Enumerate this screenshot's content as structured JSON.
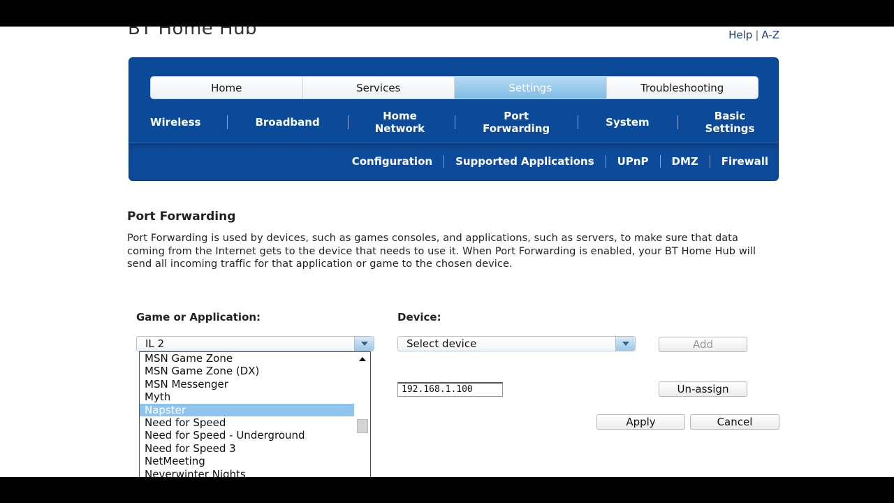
{
  "brand": "BT Home Hub",
  "help_links": {
    "help": "Help",
    "separator": "|",
    "az": "A-Z"
  },
  "main_tabs": [
    {
      "label": "Home",
      "active": false
    },
    {
      "label": "Services",
      "active": false
    },
    {
      "label": "Settings",
      "active": true
    },
    {
      "label": "Troubleshooting",
      "active": false
    }
  ],
  "sub_tabs": [
    {
      "label": "Wireless"
    },
    {
      "label": "Broadband"
    },
    {
      "label": "Home\nNetwork"
    },
    {
      "label": "Port\nForwarding"
    },
    {
      "label": "System"
    },
    {
      "label": "Basic\nSettings"
    }
  ],
  "third_tabs": [
    {
      "label": "Configuration"
    },
    {
      "label": "Supported Applications"
    },
    {
      "label": "UPnP"
    },
    {
      "label": "DMZ"
    },
    {
      "label": "Firewall"
    }
  ],
  "section": {
    "title": "Port Forwarding",
    "description": "Port Forwarding is used by devices, such as games consoles, and applications, such as servers, to make sure that data coming from the Internet gets to the device that needs to use it. When Port Forwarding is enabled, your BT Home Hub will send all incoming traffic for that application or game to the chosen device."
  },
  "form": {
    "game_label": "Game or Application:",
    "game_value": "IL 2",
    "device_label": "Device:",
    "device_value": "Select device",
    "add_label": "Add",
    "ip_value": "192.168.1.100",
    "unassign_label": "Un-assign",
    "apply_label": "Apply",
    "cancel_label": "Cancel"
  },
  "dropdown_items": [
    {
      "label": "MSN Game Zone",
      "selected": false
    },
    {
      "label": "MSN Game Zone (DX)",
      "selected": false
    },
    {
      "label": "MSN Messenger",
      "selected": false
    },
    {
      "label": "Myth",
      "selected": false
    },
    {
      "label": "Napster",
      "selected": true
    },
    {
      "label": "Need for Speed",
      "selected": false
    },
    {
      "label": "Need for Speed - Underground",
      "selected": false
    },
    {
      "label": "Need for Speed 3",
      "selected": false
    },
    {
      "label": "NetMeeting",
      "selected": false
    },
    {
      "label": "Neverwinter Nights",
      "selected": false
    }
  ],
  "colors": {
    "nav_blue": "#0b4a99",
    "active_tab": "#7fbce6",
    "selected_item": "#8fc4ee",
    "link": "#1c3f7a"
  }
}
